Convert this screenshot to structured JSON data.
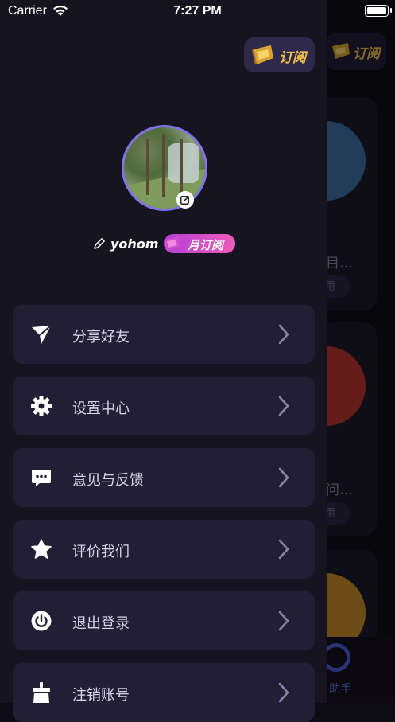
{
  "status_bar": {
    "carrier": "Carrier",
    "time": "7:27 PM"
  },
  "drawer": {
    "subscribe_label": "订阅",
    "username": "yohom",
    "membership_badge": "月订阅",
    "menu": [
      {
        "label": "分享好友",
        "icon": "share-send-icon"
      },
      {
        "label": "设置中心",
        "icon": "gear-icon"
      },
      {
        "label": "意见与反馈",
        "icon": "chat-bubble-icon"
      },
      {
        "label": "评价我们",
        "icon": "star-icon"
      },
      {
        "label": "退出登录",
        "icon": "power-icon"
      },
      {
        "label": "注销账号",
        "icon": "brush-clear-icon"
      }
    ]
  },
  "background_app": {
    "subscribe_label": "订阅",
    "card_texts": [
      "目…",
      "用",
      "问…",
      "用"
    ],
    "tab_label": "助手"
  },
  "colors": {
    "drawer_bg": "#171421",
    "menu_item_bg": "#221f35",
    "accent_purple": "#7f74e8",
    "subscribe_gold": "#f4c14a",
    "badge_pink": "#f05bb8"
  }
}
